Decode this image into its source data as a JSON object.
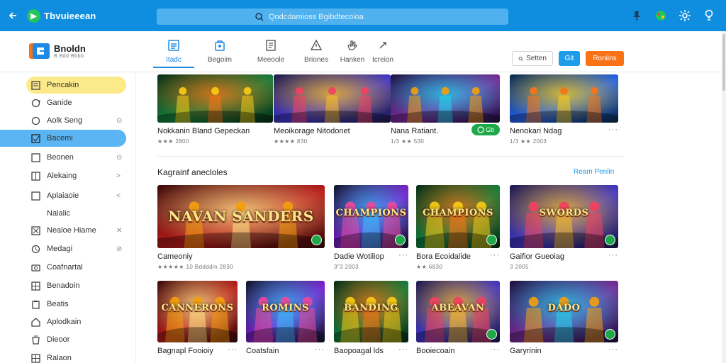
{
  "titlebar": {
    "brand": "Tbvuieeean",
    "search_placeholder": "Qodcdamioss Bgibdtecoioa"
  },
  "app": {
    "name": "Bnoldn",
    "sub": "B Bdd Bbbb"
  },
  "tabs": [
    {
      "label": "Itadc",
      "icon": "list-icon"
    },
    {
      "label": "Begoim",
      "icon": "bag-icon"
    },
    {
      "label": "Meeoole",
      "icon": "document-icon"
    },
    {
      "label": "Briones",
      "icon": "warning-icon"
    },
    {
      "label": "Hanken",
      "icon": "hand-icon"
    },
    {
      "label": "Icreion",
      "icon": "arrow-icon"
    }
  ],
  "header_buttons": {
    "search": "Setten",
    "blue": "Git",
    "orange": "Roniins"
  },
  "sidebar": [
    {
      "label": "Pencakin",
      "icon": "note-icon",
      "arrow": ""
    },
    {
      "label": "Ganide",
      "icon": "loop-icon",
      "arrow": ""
    },
    {
      "label": "Aolk Seng",
      "icon": "circle-icon",
      "arrow": "⊙"
    },
    {
      "label": "Bacemi",
      "icon": "check-icon",
      "arrow": ""
    },
    {
      "label": "Beonen",
      "icon": "square-icon",
      "arrow": "⊙"
    },
    {
      "label": "Alekaing",
      "icon": "board-icon",
      "arrow": ">"
    },
    {
      "label": "Aplaiaoie",
      "icon": "square-icon",
      "arrow": "<"
    },
    {
      "label": "Nalalic",
      "icon": "",
      "arrow": ""
    },
    {
      "label": "Nealoe Hiame",
      "icon": "cross-icon",
      "arrow": "✕"
    },
    {
      "label": "Medagi",
      "icon": "clock-icon",
      "arrow": "⊘"
    },
    {
      "label": "Coafnartal",
      "icon": "camera-icon",
      "arrow": ""
    },
    {
      "label": "Benadoin",
      "icon": "grid-icon",
      "arrow": ""
    },
    {
      "label": "Beatis",
      "icon": "clipboard-icon",
      "arrow": ""
    },
    {
      "label": "Aplodkain",
      "icon": "house-icon",
      "arrow": ""
    },
    {
      "label": "Dieoor",
      "icon": "bucket-icon",
      "arrow": ""
    },
    {
      "label": "Ralaon",
      "icon": "grid-icon",
      "arrow": ""
    }
  ],
  "featured": [
    {
      "title": "Nokkanin Bland Gepeckan",
      "meta": "★★★ 2800"
    },
    {
      "title": "Meoikorage Nitodonet",
      "meta": "★★★★ 830"
    },
    {
      "title": "Nana Ratiant.",
      "meta": "1/3 ★★ 530"
    },
    {
      "title": "Nenokari Ndag",
      "meta": "1/3 ★★ 2003"
    }
  ],
  "featured_badge": "Gb",
  "section": {
    "title": "Kagrainf anecloles",
    "link": "Ream Penlin"
  },
  "row1": [
    {
      "title": "Cameoniy",
      "meta": "★★★★★ 10 Bddddin 2830",
      "img_text": "NAVAN SANDERS"
    },
    {
      "title": "Dadie Wotiliop",
      "meta": "3\"3 2003",
      "img_text": "CHAMPIONS"
    },
    {
      "title": "Bora Ecoidalide",
      "meta": "★★ 6830",
      "img_text": "CHAMPIONS"
    },
    {
      "title": "Gaifior Gueoiag",
      "meta": "3 2005",
      "img_text": "SWORDS"
    }
  ],
  "row2": [
    {
      "title": "Bagnapl Fooioiy",
      "img_text": "CANNERONS"
    },
    {
      "title": "Coatsfain",
      "img_text": "ROMINS"
    },
    {
      "title": "Baopoagal lds",
      "img_text": "BANDING"
    },
    {
      "title": "Booiecoain",
      "img_text": "ABEAVAN"
    },
    {
      "title": "Garyrinin",
      "img_text": "DADO"
    }
  ],
  "colors": {
    "titlebar": "#0f8ee0",
    "accent_blue": "#1e9be9",
    "accent_orange": "#f97316",
    "highlight_yellow": "#fbe98a",
    "highlight_blue": "#5bb5f3",
    "play_green": "#1ea84a"
  }
}
